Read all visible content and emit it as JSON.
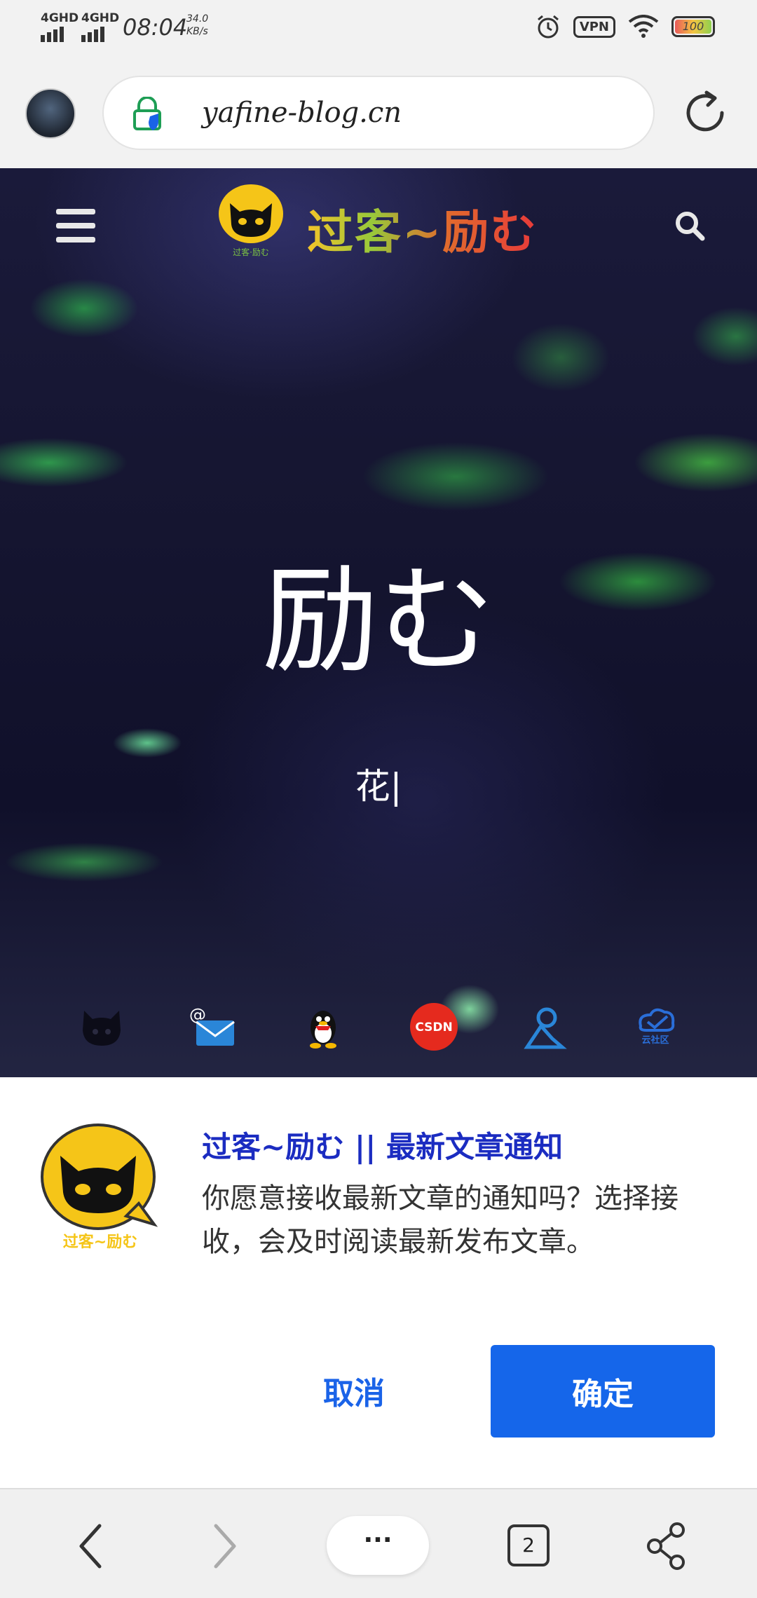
{
  "status_bar": {
    "signal1": "4GHD",
    "signal2": "4GHD",
    "time": "08:04",
    "net_speed_value": "34.0",
    "net_speed_unit": "KB/s",
    "vpn": "VPN",
    "battery": "100"
  },
  "address_bar": {
    "url": "yafine-blog.cn"
  },
  "hero": {
    "brand": "过客~励む",
    "logo_caption": "过客·励む",
    "title": "励む",
    "typed_text": "花|"
  },
  "social_icons": [
    "github-icon",
    "email-icon",
    "qq-icon",
    "csdn-icon",
    "location-icon",
    "cloud-community-icon"
  ],
  "social_labels": {
    "csdn": "CSDN",
    "cloud": "云社区"
  },
  "notification": {
    "title": "过客~励む || 最新文章通知",
    "message": "你愿意接收最新文章的通知吗？选择接收，会及时阅读最新发布文章。",
    "logo_caption": "过客~励む",
    "cancel_label": "取消",
    "ok_label": "确定"
  },
  "bottom_nav": {
    "menu_label": "···",
    "tabs_count": "2"
  },
  "colors": {
    "accent_blue": "#1566ea",
    "title_blue": "#1b2cc1"
  }
}
